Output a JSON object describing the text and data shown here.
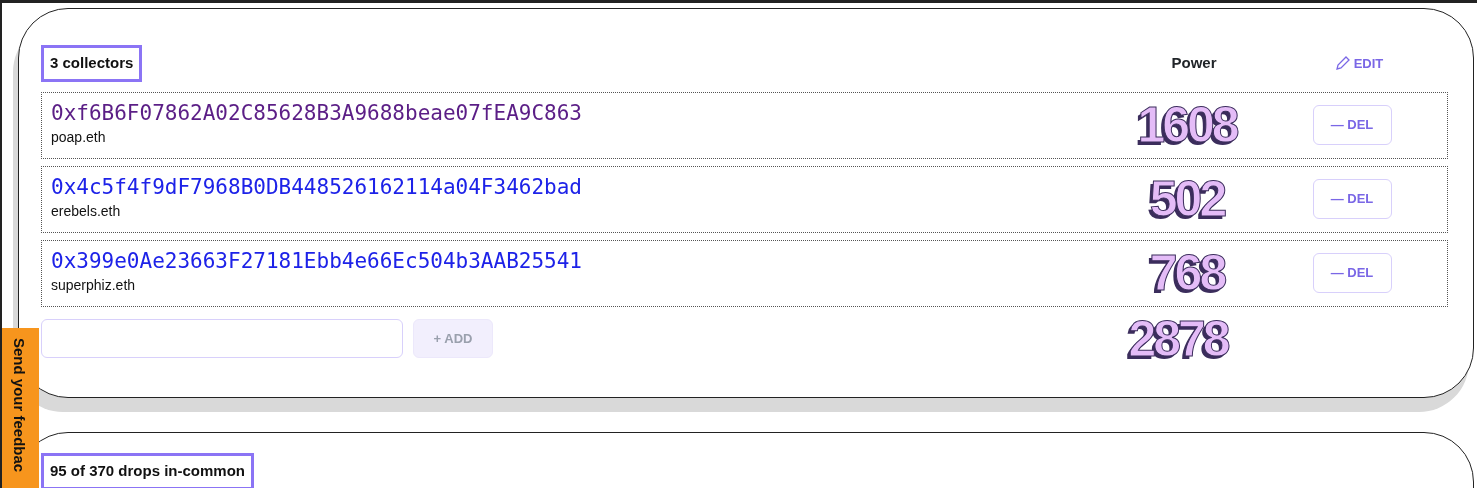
{
  "collectors_panel": {
    "title": "3 collectors",
    "power_heading": "Power",
    "edit_button": "EDIT",
    "collectors": [
      {
        "address": "0xf6B6F07862A02C85628B3A9688beae07fEA9C863",
        "ens": "poap.eth",
        "visited": true,
        "power": "1608",
        "remove_button": "— DEL"
      },
      {
        "address": "0x4c5f4f9dF7968B0DB448526162114a04F3462bad",
        "ens": "erebels.eth",
        "visited": false,
        "power": "502",
        "remove_button": "— DEL"
      },
      {
        "address": "0x399e0Ae23663F27181Ebb4e66Ec504b3AAB25541",
        "ens": "superphiz.eth",
        "visited": false,
        "power": "768",
        "remove_button": "— DEL"
      }
    ],
    "add_button": "+ ADD",
    "total_power": "2878"
  },
  "drops_panel": {
    "title": "95 of 370 drops in-common"
  },
  "feedback_tab": "Send your feedbac"
}
